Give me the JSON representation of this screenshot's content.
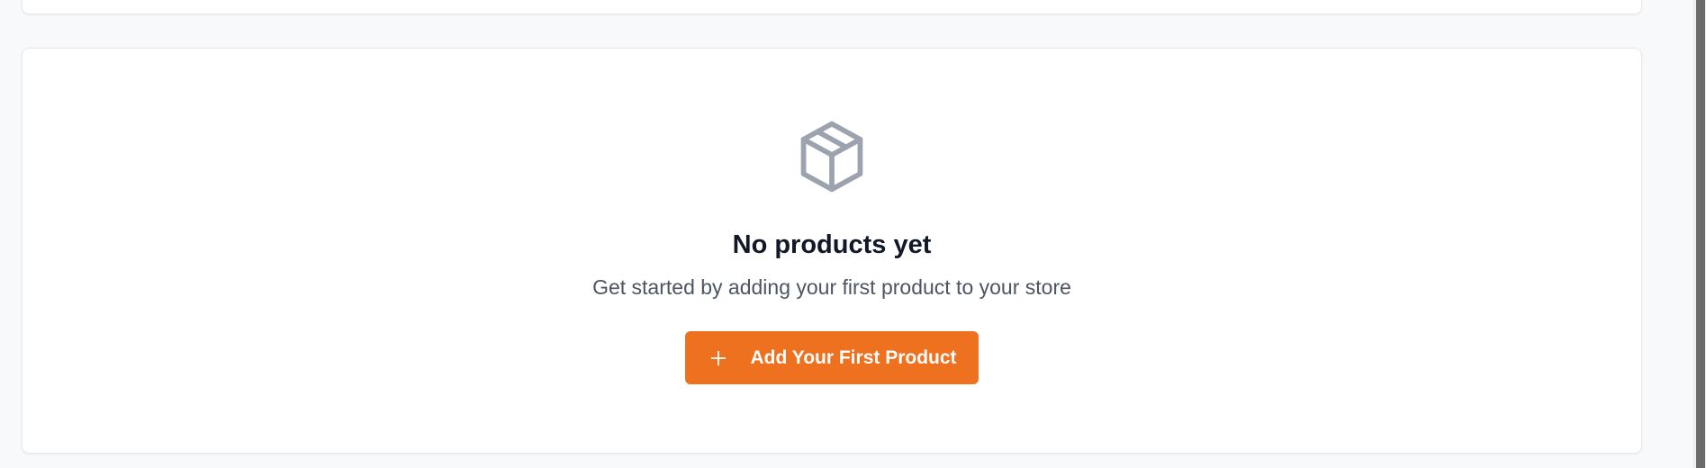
{
  "empty_state": {
    "icon": "package-box-icon",
    "title": "No products yet",
    "description": "Get started by adding your first product to your store",
    "button_label": "Add Your First Product",
    "button_icon": "plus-icon"
  },
  "colors": {
    "accent": "#ee711f",
    "icon_gray": "#9ca3af",
    "title": "#111827",
    "description": "#4b5563",
    "page_background": "#f8f9fa"
  }
}
